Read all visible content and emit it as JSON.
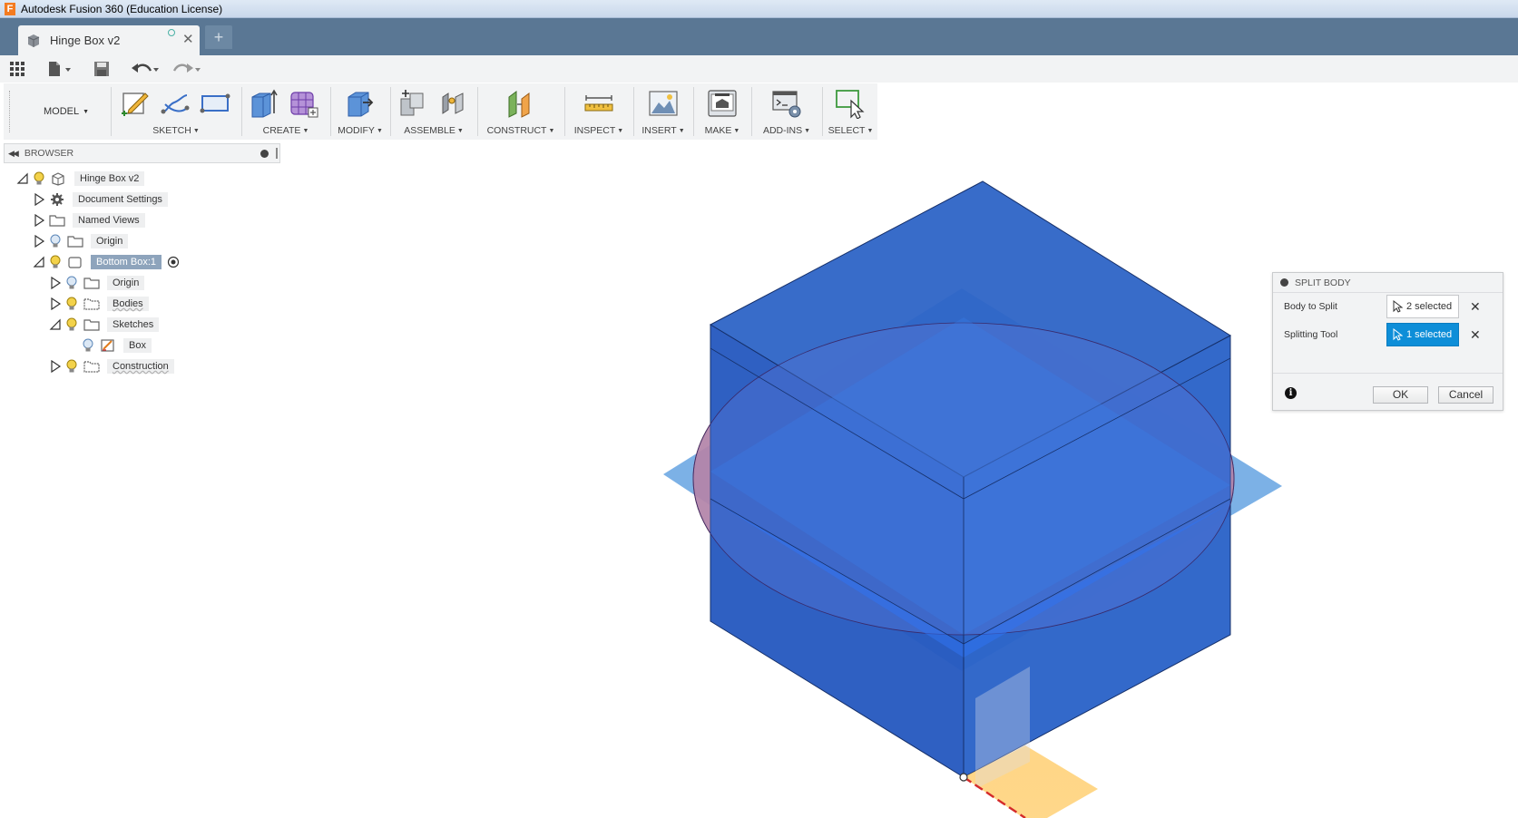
{
  "window": {
    "title": "Autodesk Fusion 360 (Education License)"
  },
  "tab": {
    "title": "Hinge Box v2",
    "new_tab_symbol": "+"
  },
  "toolbar": {
    "workspace": "MODEL",
    "groups": [
      {
        "label": "SKETCH"
      },
      {
        "label": "CREATE"
      },
      {
        "label": "MODIFY"
      },
      {
        "label": "ASSEMBLE"
      },
      {
        "label": "CONSTRUCT"
      },
      {
        "label": "INSPECT"
      },
      {
        "label": "INSERT"
      },
      {
        "label": "MAKE"
      },
      {
        "label": "ADD-INS"
      },
      {
        "label": "SELECT"
      }
    ]
  },
  "browser": {
    "title": "BROWSER",
    "nodes": [
      {
        "label": "Hinge Box v2"
      },
      {
        "label": "Document Settings"
      },
      {
        "label": "Named Views"
      },
      {
        "label": "Origin"
      },
      {
        "label": "Bottom Box:1"
      },
      {
        "label": "Origin"
      },
      {
        "label": "Bodies"
      },
      {
        "label": "Sketches"
      },
      {
        "label": "Box"
      },
      {
        "label": "Construction"
      }
    ]
  },
  "split_body": {
    "title": "SPLIT BODY",
    "body_to_split_label": "Body to Split",
    "body_to_split_value": "2 selected",
    "splitting_tool_label": "Splitting Tool",
    "splitting_tool_value": "1 selected",
    "ok_label": "OK",
    "cancel_label": "Cancel"
  },
  "colors": {
    "title_bar": "#d4e1f0",
    "tab_bar": "#5a7794",
    "body_blue": "#2a62c4",
    "plane_red": "#e88a8a",
    "plane_blue": "#5b9ee0",
    "selection_blue": "#0e8ed8"
  }
}
